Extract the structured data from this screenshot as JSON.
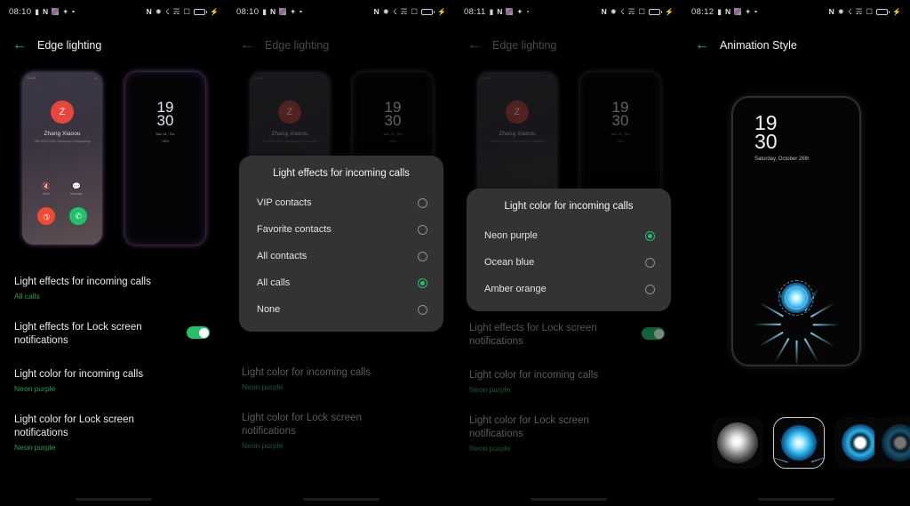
{
  "panels": [
    {
      "id": "panel-edge-lighting-main",
      "status_bar": {
        "time": "08:10",
        "left_icons": [
          "message-icon",
          "n-badge-icon",
          "photo-icon",
          "bluetooth-audio-icon",
          "dot-icon"
        ],
        "right_icons": [
          "nfc-icon",
          "bluetooth-icon",
          "vibrate-icon",
          "wifi-icon",
          "sim-icon",
          "battery-charging-icon"
        ],
        "battery_charging": true
      },
      "appbar": {
        "back": "back-arrow",
        "title": "Edge lighting"
      },
      "preview": {
        "call_phone": {
          "mini_status_left": "19:30",
          "mini_status_right": "▪▪",
          "avatar_initial": "Z",
          "caller_name": "Zhang Xiaoou",
          "caller_sub": "+86 0000 0000  Shenzhen,Guangdong",
          "action_mute": "Mute",
          "action_message": "Message",
          "decline_label": "decline-call",
          "accept_label": "accept-call"
        },
        "lock_phone": {
          "hours": "19",
          "minutes": "30",
          "date": "Mon 14 , Thu",
          "battery": "100%"
        }
      },
      "settings": [
        {
          "title": "Light effects for incoming calls",
          "value": "All calls",
          "toggle": null
        },
        {
          "title": "Light effects for Lock screen notifications",
          "value": null,
          "toggle": "on"
        },
        {
          "title": "Light color for incoming calls",
          "value": "Neon purple",
          "toggle": null
        },
        {
          "title": "Light color for Lock screen notifications",
          "value": "Neon purple",
          "toggle": null
        }
      ],
      "dialog": null
    },
    {
      "id": "panel-light-effects-dialog",
      "status_bar": {
        "time": "08:10"
      },
      "appbar": {
        "back": "back-arrow",
        "title": "Edge lighting"
      },
      "settings": [
        {
          "title": "Light color for incoming calls",
          "value": "Neon purple",
          "toggle": null
        },
        {
          "title": "Light color for Lock screen notifications",
          "value": "Neon purple",
          "toggle": null
        }
      ],
      "dialog": {
        "title": "Light effects for incoming calls",
        "options": [
          {
            "label": "VIP contacts",
            "selected": false
          },
          {
            "label": "Favorite contacts",
            "selected": false
          },
          {
            "label": "All contacts",
            "selected": false
          },
          {
            "label": "All calls",
            "selected": true
          },
          {
            "label": "None",
            "selected": false
          }
        ]
      }
    },
    {
      "id": "panel-light-color-dialog",
      "status_bar": {
        "time": "08:11"
      },
      "appbar": {
        "back": "back-arrow",
        "title": "Edge lighting"
      },
      "settings": [
        {
          "title": "Light effects for Lock screen notifications",
          "value": null,
          "toggle": "on"
        },
        {
          "title": "Light color for incoming calls",
          "value": "Neon purple",
          "toggle": null
        },
        {
          "title": "Light color for Lock screen notifications",
          "value": "Neon purple",
          "toggle": null
        }
      ],
      "dialog": {
        "title": "Light color for incoming calls",
        "options": [
          {
            "label": "Neon purple",
            "selected": true
          },
          {
            "label": "Ocean blue",
            "selected": false
          },
          {
            "label": "Amber orange",
            "selected": false
          }
        ]
      }
    },
    {
      "id": "panel-animation-style",
      "status_bar": {
        "time": "08:12"
      },
      "appbar": {
        "back": "back-arrow",
        "title": "Animation Style"
      },
      "animation_preview": {
        "hours": "19",
        "minutes": "30",
        "date": "Saturday, October 26th",
        "effect": "blue-burst-animation"
      },
      "thumbnails": [
        {
          "name": "white-swirl-animation",
          "selected": false
        },
        {
          "name": "blue-burst-animation",
          "selected": true
        },
        {
          "name": "blue-ring-animation",
          "selected": false
        },
        {
          "name": "partial-animation",
          "selected": false
        }
      ]
    }
  ],
  "colors": {
    "accent_green": "#1fc16b",
    "value_green": "#1ba055",
    "dialog_bg": "#333333",
    "background": "#000000",
    "avatar_red": "#e8453c",
    "accept_green": "#1fc16b",
    "decline_red": "#ef4b34"
  }
}
